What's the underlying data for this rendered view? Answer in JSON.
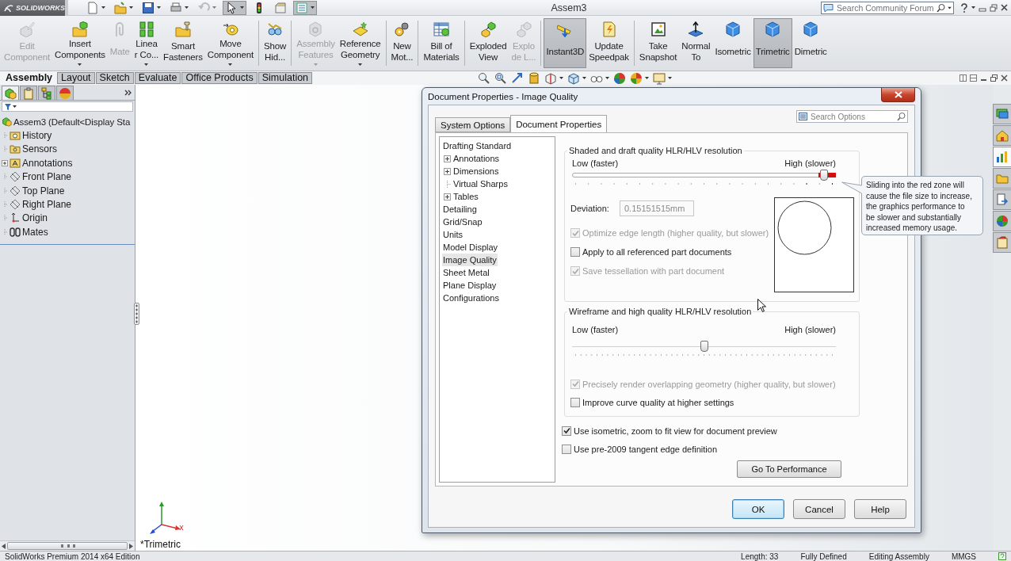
{
  "app": {
    "logo": "SOLIDWORKS",
    "title": "Assem3",
    "search": {
      "placeholder": "Search Community Forum"
    },
    "quick_access": [
      {
        "selected": false,
        "disabled": false,
        "dropdown": true
      },
      {
        "selected": false,
        "disabled": false,
        "dropdown": true
      },
      {
        "selected": false,
        "disabled": false,
        "dropdown": true
      },
      {
        "selected": false,
        "disabled": false,
        "dropdown": true
      },
      {
        "selected": false,
        "disabled": true,
        "dropdown": true
      },
      {
        "selected": true,
        "disabled": false,
        "dropdown": true
      },
      {
        "selected": false,
        "disabled": false,
        "dropdown": false
      },
      {
        "selected": false,
        "disabled": false,
        "dropdown": false
      },
      {
        "selected": true,
        "disabled": false,
        "dropdown": true
      }
    ]
  },
  "ribbon": {
    "groups": [
      {
        "commands": [
          {
            "label": "Edit\nComponent",
            "disabled": true,
            "selected": false,
            "dropdown": false
          },
          {
            "label": "Insert\nComponents",
            "disabled": false,
            "selected": false,
            "dropdown": true
          },
          {
            "label": "Mate",
            "disabled": true,
            "selected": false,
            "dropdown": false
          },
          {
            "label": "Linea\nr Co...",
            "disabled": false,
            "selected": false,
            "dropdown": true
          },
          {
            "label": "Smart\nFasteners",
            "disabled": false,
            "selected": false,
            "dropdown": false
          },
          {
            "label": "Move\nComponent",
            "disabled": false,
            "selected": false,
            "dropdown": true
          }
        ]
      },
      {
        "commands": [
          {
            "label": "Show\nHid...",
            "disabled": false,
            "selected": false,
            "dropdown": false
          }
        ]
      },
      {
        "commands": [
          {
            "label": "Assembly\nFeatures",
            "disabled": true,
            "selected": false,
            "dropdown": true
          },
          {
            "label": "Reference\nGeometry",
            "disabled": false,
            "selected": false,
            "dropdown": true
          }
        ]
      },
      {
        "commands": [
          {
            "label": "New\nMot...",
            "disabled": false,
            "selected": false,
            "dropdown": false
          }
        ]
      },
      {
        "commands": [
          {
            "label": "Bill of\nMaterials",
            "disabled": false,
            "selected": false,
            "dropdown": false
          }
        ]
      },
      {
        "commands": [
          {
            "label": "Exploded\nView",
            "disabled": false,
            "selected": false,
            "dropdown": false
          },
          {
            "label": "Explo\nde L...",
            "disabled": true,
            "selected": false,
            "dropdown": false
          }
        ]
      },
      {
        "commands": [
          {
            "label": "Instant3D",
            "disabled": false,
            "selected": true,
            "dropdown": false
          },
          {
            "label": "Update\nSpeedpak",
            "disabled": false,
            "selected": false,
            "dropdown": false
          }
        ]
      },
      {
        "commands": [
          {
            "label": "Take\nSnapshot",
            "disabled": false,
            "selected": false,
            "dropdown": false
          },
          {
            "label": "Normal\nTo",
            "disabled": false,
            "selected": false,
            "dropdown": false
          },
          {
            "label": "Isometric",
            "disabled": false,
            "selected": false,
            "dropdown": false
          },
          {
            "label": "Trimetric",
            "disabled": false,
            "selected": true,
            "dropdown": false
          },
          {
            "label": "Dimetric",
            "disabled": false,
            "selected": false,
            "dropdown": false
          }
        ]
      }
    ]
  },
  "command_tabs": [
    {
      "label": "Assembly",
      "selected": true
    },
    {
      "label": "Layout",
      "selected": false
    },
    {
      "label": "Sketch",
      "selected": false
    },
    {
      "label": "Evaluate",
      "selected": false
    },
    {
      "label": "Office Products",
      "selected": false
    },
    {
      "label": "Simulation",
      "selected": false
    }
  ],
  "view_toolbar": [
    {
      "dropdown": false
    },
    {
      "dropdown": false
    },
    {
      "dropdown": false
    },
    {
      "dropdown": false
    },
    {
      "dropdown": true
    },
    {
      "dropdown": true
    },
    {
      "dropdown": true
    },
    {
      "dropdown": false
    },
    {
      "dropdown": true
    },
    {
      "dropdown": true
    }
  ],
  "feature_tree": {
    "panel_tabs": [
      {
        "selected": true
      },
      {
        "selected": false
      },
      {
        "selected": false
      },
      {
        "selected": false
      }
    ],
    "root": {
      "label": "Assem3 (Default<Display Sta",
      "children": [
        {
          "label": "History",
          "collapsed": false
        },
        {
          "label": "Sensors",
          "collapsed": false
        },
        {
          "label": "Annotations",
          "collapsed": true
        },
        {
          "label": "Front Plane",
          "collapsed": false
        },
        {
          "label": "Top Plane",
          "collapsed": false
        },
        {
          "label": "Right Plane",
          "collapsed": false
        },
        {
          "label": "Origin",
          "collapsed": false
        },
        {
          "label": "Mates",
          "collapsed": false
        }
      ]
    }
  },
  "graphics": {
    "view_name": "*Trimetric"
  },
  "task_pane": [
    {
      "selected": false
    },
    {
      "selected": false
    },
    {
      "selected": true
    },
    {
      "selected": false
    },
    {
      "selected": false
    },
    {
      "selected": false
    },
    {
      "selected": false
    }
  ],
  "dialog": {
    "title": "Document Properties - Image Quality",
    "tabs": [
      {
        "label": "System Options",
        "selected": false
      },
      {
        "label": "Document Properties",
        "selected": true
      }
    ],
    "search": {
      "placeholder": "Search Options"
    },
    "nav": [
      {
        "label": "Drafting Standard",
        "selected": false,
        "children": [
          {
            "label": "Annotations",
            "selected": false,
            "collapsed": true
          },
          {
            "label": "Dimensions",
            "selected": false,
            "collapsed": true
          },
          {
            "label": "Virtual Sharps",
            "selected": false,
            "collapsed": false
          },
          {
            "label": "Tables",
            "selected": false,
            "collapsed": true
          }
        ]
      },
      {
        "label": "Detailing",
        "selected": false
      },
      {
        "label": "Grid/Snap",
        "selected": false
      },
      {
        "label": "Units",
        "selected": false
      },
      {
        "label": "Model Display",
        "selected": false
      },
      {
        "label": "Image Quality",
        "selected": true
      },
      {
        "label": "Sheet Metal",
        "selected": false
      },
      {
        "label": "Plane Display",
        "selected": false
      },
      {
        "label": "Configurations",
        "selected": false
      }
    ],
    "sections": [
      {
        "title": "Shaded and draft quality HLR/HLV resolution",
        "low": "Low (faster)",
        "high": "High (slower)",
        "level": 0.97,
        "red_zone": true,
        "tooltip": "Sliding into the red zone will cause the file size to increase, the graphics performance to be slower and substantially increased memory usage.",
        "deviation": {
          "label": "Deviation:",
          "value": "0.15151515mm",
          "disabled": true
        },
        "preview": true,
        "options": [
          {
            "label": "Optimize edge length (higher quality, but slower)",
            "checked": true,
            "disabled": true
          },
          {
            "label": "Apply to all referenced part documents",
            "checked": false,
            "disabled": false
          },
          {
            "label": "Save tessellation with part document",
            "checked": true,
            "disabled": true
          }
        ]
      },
      {
        "title": "Wireframe and high quality HLR/HLV resolution",
        "low": "Low (faster)",
        "high": "High (slower)",
        "level": 0.5,
        "red_zone": false,
        "preview": false,
        "options": [
          {
            "label": "Precisely render overlapping geometry (higher quality, but slower)",
            "checked": true,
            "disabled": true
          },
          {
            "label": "Improve curve quality at higher settings",
            "checked": false,
            "disabled": false
          }
        ]
      }
    ],
    "options": [
      {
        "label": "Use isometric, zoom to fit view for document preview",
        "checked": true,
        "disabled": false
      },
      {
        "label": "Use pre-2009 tangent edge definition",
        "checked": false,
        "disabled": false
      }
    ],
    "performance_button": "Go To Performance",
    "buttons": [
      {
        "label": "OK",
        "default": true
      },
      {
        "label": "Cancel",
        "default": false
      },
      {
        "label": "Help",
        "default": false
      }
    ]
  },
  "status_bar": {
    "product": "SolidWorks Premium 2014 x64 Edition",
    "items": [
      "Length: 33",
      "Fully Defined",
      "Editing Assembly",
      "MMGS"
    ]
  }
}
